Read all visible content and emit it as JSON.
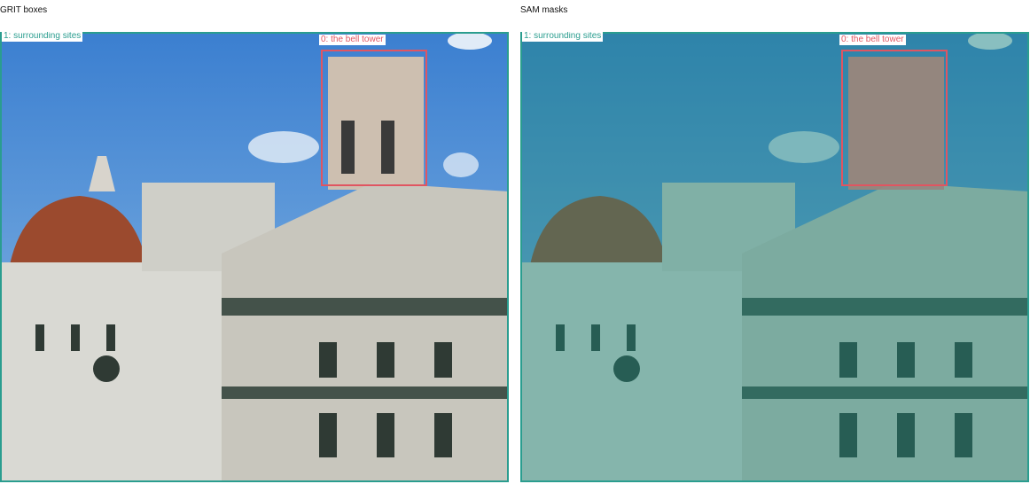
{
  "panels": [
    {
      "title": "GRIT boxes",
      "boxes": [
        {
          "label": "1: surrounding sites",
          "color": "#2a9d8f"
        },
        {
          "label": "0: the bell tower",
          "color": "#e05561"
        }
      ]
    },
    {
      "title": "SAM masks",
      "boxes": [
        {
          "label": "1: surrounding sites",
          "color": "#2a9d8f"
        },
        {
          "label": "0: the bell tower",
          "color": "#e05561"
        }
      ],
      "mask_colors": {
        "surrounding_sites": "#1f8a7c",
        "bell_tower": "#b06060"
      }
    }
  ],
  "image_content": "Florence Cathedral (Duomo), Giotto's bell tower and the Baptistery under a blue sky with clouds"
}
